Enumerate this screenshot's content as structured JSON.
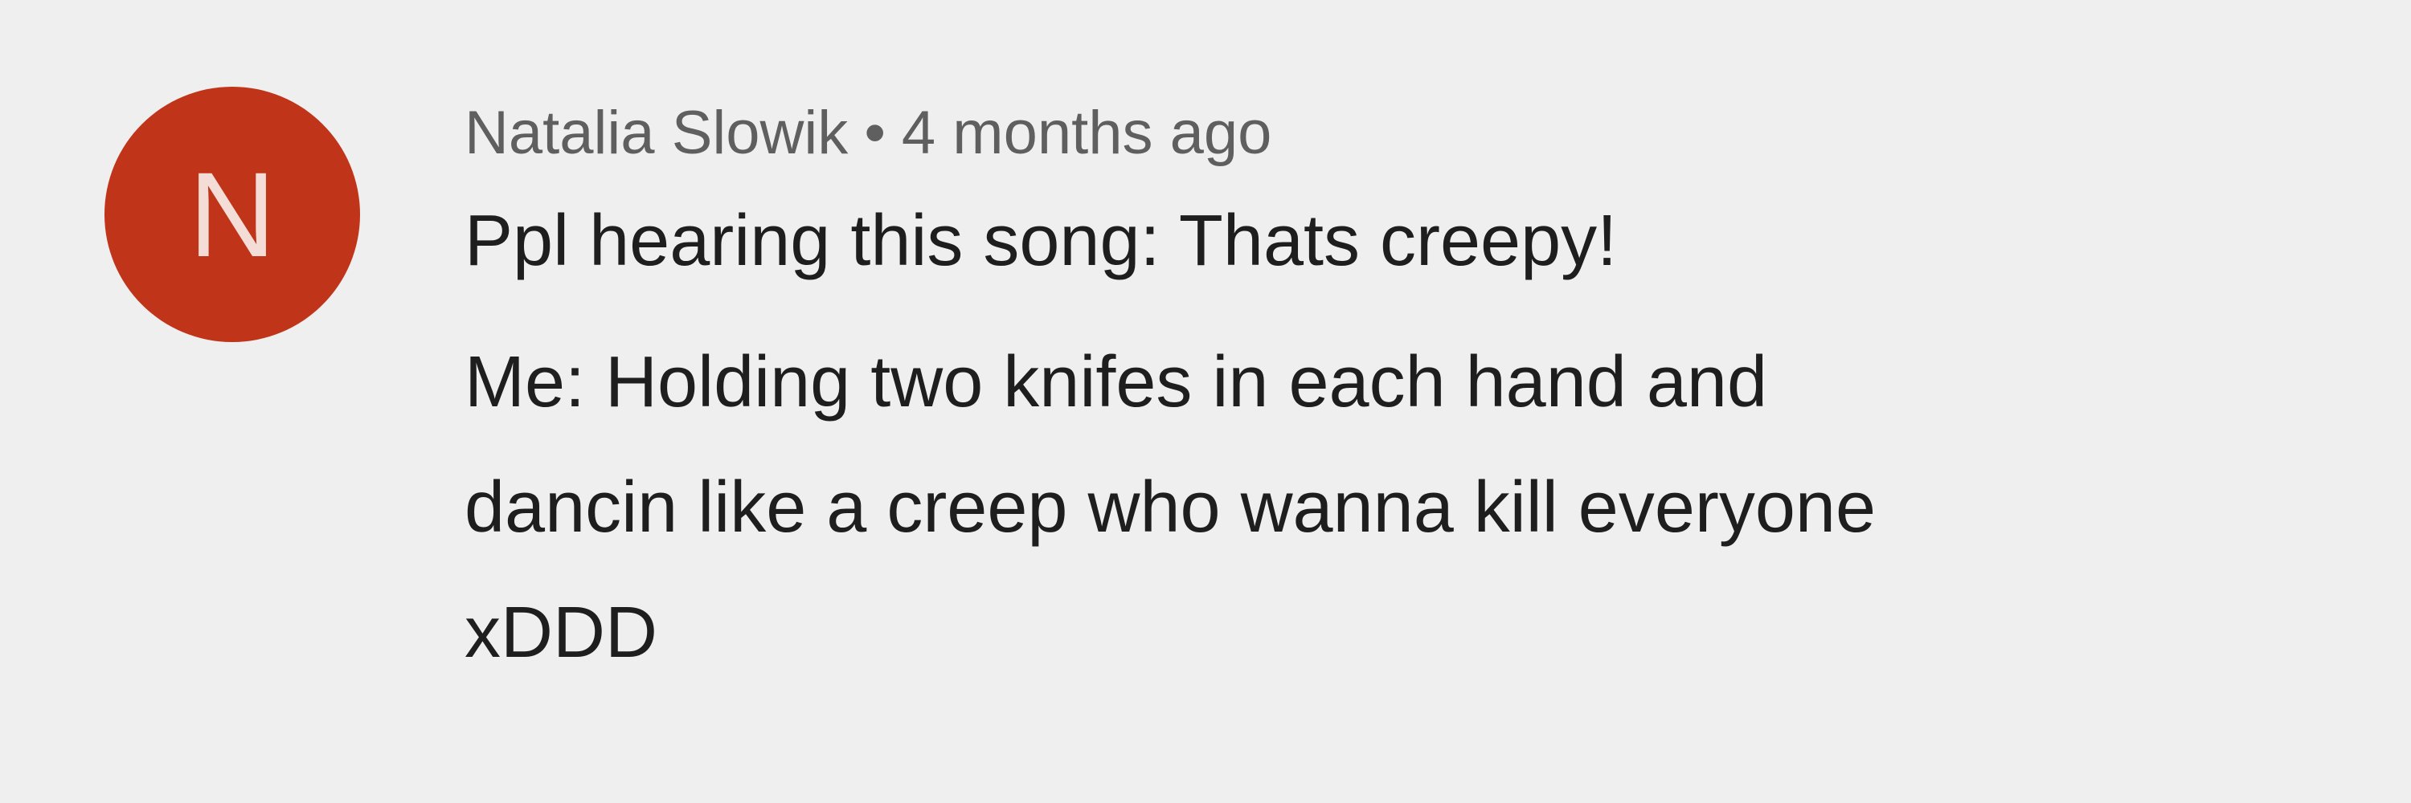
{
  "comment": {
    "avatar_letter": "N",
    "author": "Natalia Slowik",
    "separator": "•",
    "timestamp": "4 months ago",
    "lines": [
      "Ppl hearing this song: Thats creepy!",
      "Me: Holding two knifes in each hand and",
      "dancin like a creep who wanna kill everyone",
      "xDDD"
    ]
  },
  "colors": {
    "background": "#efefef",
    "avatar": "#c0351a",
    "meta_text": "#5f5f5f",
    "body_text": "#1e1e1e"
  }
}
